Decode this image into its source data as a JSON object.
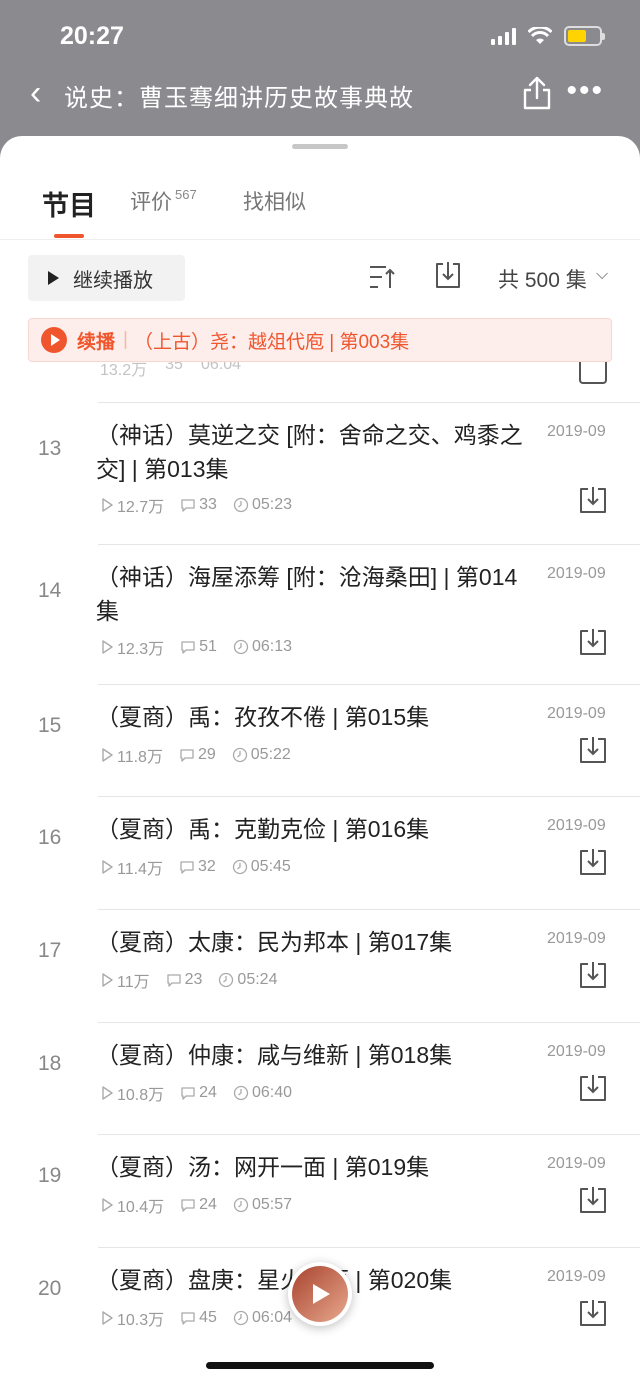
{
  "status": {
    "time": "20:27"
  },
  "nav": {
    "title": "说史：曹玉骞细讲历史故事典故"
  },
  "tabs": [
    {
      "label": "节目"
    },
    {
      "label": "评价",
      "count": "567"
    },
    {
      "label": "找相似"
    }
  ],
  "toolbar": {
    "continue_label": "继续播放",
    "total_label": "共 500 集"
  },
  "resume": {
    "label": "续播",
    "episode": "（上古）尧：越俎代庖 | 第003集"
  },
  "partial_row": {
    "plays": "13.2万",
    "comments": "35",
    "duration": "06:04"
  },
  "episodes": [
    {
      "num": "13",
      "title": "（神话）莫逆之交 [附：舍命之交、鸡黍之交] | 第013集",
      "date": "2019-09",
      "plays": "12.7万",
      "comments": "33",
      "duration": "05:23"
    },
    {
      "num": "14",
      "title": "（神话）海屋添筹 [附：沧海桑田] | 第014集",
      "date": "2019-09",
      "plays": "12.3万",
      "comments": "51",
      "duration": "06:13"
    },
    {
      "num": "15",
      "title": "（夏商）禹：孜孜不倦 | 第015集",
      "date": "2019-09",
      "plays": "11.8万",
      "comments": "29",
      "duration": "05:22"
    },
    {
      "num": "16",
      "title": "（夏商）禹：克勤克俭 | 第016集",
      "date": "2019-09",
      "plays": "11.4万",
      "comments": "32",
      "duration": "05:45"
    },
    {
      "num": "17",
      "title": "（夏商）太康：民为邦本 | 第017集",
      "date": "2019-09",
      "plays": "11万",
      "comments": "23",
      "duration": "05:24"
    },
    {
      "num": "18",
      "title": "（夏商）仲康：咸与维新 | 第018集",
      "date": "2019-09",
      "plays": "10.8万",
      "comments": "24",
      "duration": "06:40"
    },
    {
      "num": "19",
      "title": "（夏商）汤：网开一面 | 第019集",
      "date": "2019-09",
      "plays": "10.4万",
      "comments": "24",
      "duration": "05:57"
    },
    {
      "num": "20",
      "title": "（夏商）盘庚：星火燎原 | 第020集",
      "date": "2019-09",
      "plays": "10.3万",
      "comments": "45",
      "duration": "06:04"
    }
  ],
  "colors": {
    "accent": "#f0562d",
    "resume_bg": "#fdeeec"
  },
  "icons": {
    "back": "chevron-left-icon",
    "share": "share-icon",
    "more": "more-icon",
    "sort": "sort-icon",
    "download": "download-icon",
    "play": "play-icon",
    "comment": "comment-icon",
    "clock": "clock-icon"
  }
}
